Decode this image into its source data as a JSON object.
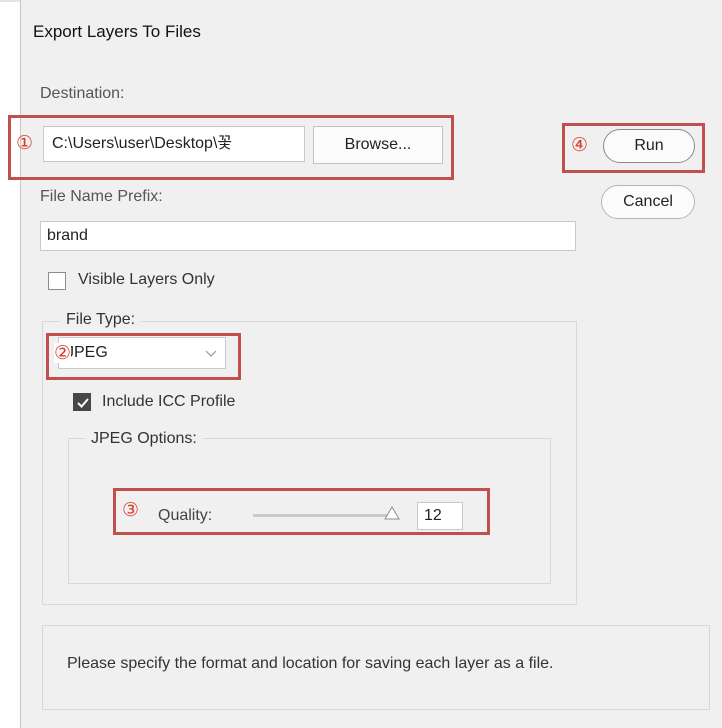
{
  "dialog": {
    "title": "Export Layers To Files",
    "destination_label": "Destination:",
    "destination_value": "C:\\Users\\user\\Desktop\\꽃",
    "browse_label": "Browse...",
    "run_label": "Run",
    "cancel_label": "Cancel",
    "prefix_label": "File Name Prefix:",
    "prefix_value": "brand",
    "visible_only_label": "Visible Layers Only",
    "visible_only_checked": false,
    "file_type_legend": "File Type:",
    "file_type_value": "JPEG",
    "icc_label": "Include ICC Profile",
    "icc_checked": true,
    "jpeg_options_legend": "JPEG Options:",
    "quality_label": "Quality:",
    "quality_value": "12",
    "quality_slider_fraction": 1.0,
    "message": "Please specify the format and location for saving each layer as a file."
  },
  "annotations": {
    "one": "①",
    "two": "②",
    "three": "③",
    "four": "④"
  },
  "colors": {
    "annotation_red": "#c0504d",
    "annotation_number": "#d83c2c",
    "dialog_bg": "#f0f0f0"
  }
}
